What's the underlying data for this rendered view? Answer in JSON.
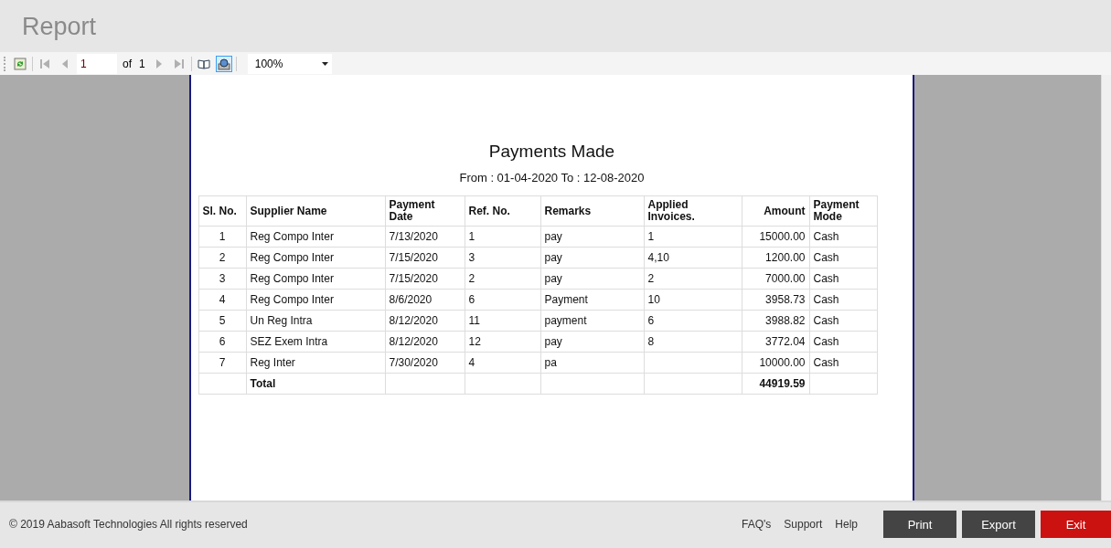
{
  "window": {
    "title": "Report"
  },
  "toolbar": {
    "page_field": "1",
    "of_label": "of",
    "page_count": "1",
    "zoom": "100%",
    "print_layout_selected": true
  },
  "report": {
    "title": "Payments Made",
    "period": "From : 01-04-2020 To : 12-08-2020",
    "columns": [
      "Sl. No.",
      "Supplier Name",
      "Payment Date",
      "Ref. No.",
      "Remarks",
      "Applied Invoices.",
      "Amount",
      "Payment Mode"
    ],
    "rows": [
      [
        "1",
        "Reg Compo Inter",
        "7/13/2020",
        "1",
        "pay",
        "1",
        "15000.00",
        "Cash"
      ],
      [
        "2",
        "Reg Compo Inter",
        "7/15/2020",
        "3",
        "pay",
        "4,10",
        "1200.00",
        "Cash"
      ],
      [
        "3",
        "Reg Compo Inter",
        "7/15/2020",
        "2",
        "pay",
        "2",
        "7000.00",
        "Cash"
      ],
      [
        "4",
        "Reg Compo Inter",
        "8/6/2020",
        "6",
        "Payment",
        "10",
        "3958.73",
        "Cash"
      ],
      [
        "5",
        "Un Reg Intra",
        "8/12/2020",
        "11",
        "payment",
        "6",
        "3988.82",
        "Cash"
      ],
      [
        "6",
        "SEZ Exem Intra",
        "8/12/2020",
        "12",
        "pay",
        "8",
        "3772.04",
        "Cash"
      ],
      [
        "7",
        "Reg Inter",
        "7/30/2020",
        "4",
        "pa",
        "",
        "10000.00",
        "Cash"
      ]
    ],
    "total": {
      "label": "Total",
      "amount": "44919.59"
    }
  },
  "footer": {
    "copyright": "© 2019 Aabasoft Technologies All rights reserved",
    "links": [
      "FAQ's",
      "Support",
      "Help"
    ],
    "buttons": [
      {
        "label": "Print",
        "kind": "dark"
      },
      {
        "label": "Export",
        "kind": "dark"
      },
      {
        "label": "Exit",
        "kind": "danger"
      }
    ]
  }
}
